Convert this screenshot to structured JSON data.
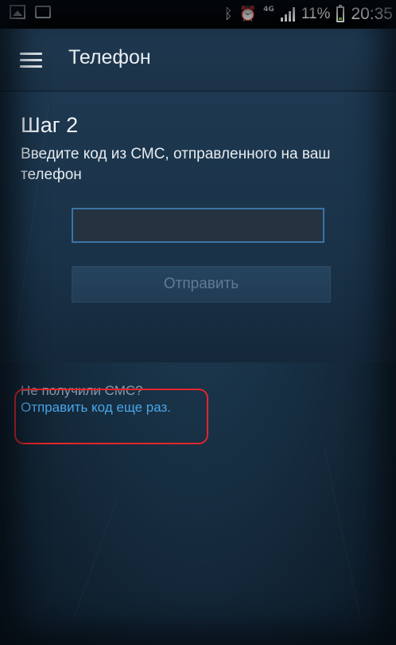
{
  "status_bar": {
    "network": "4G",
    "battery_percent": "11%",
    "time": "20:35",
    "icons": [
      "image-icon",
      "chat-icon",
      "bluetooth-icon",
      "alarm-icon",
      "signal-icon",
      "battery-icon"
    ]
  },
  "action_bar": {
    "title": "Телефон",
    "menu_icon": "hamburger-menu-icon"
  },
  "step": {
    "title": "Шаг 2",
    "description": "Введите код из СМС, отправленного на ваш телефон",
    "code_value": "",
    "send_label": "Отправить"
  },
  "resend": {
    "question": "Не получили СМС?",
    "link_label": "Отправить код еще раз."
  },
  "colors": {
    "accent_link": "#4aa6e8",
    "highlight": "#e2262b",
    "input_border": "#3a74a6"
  }
}
